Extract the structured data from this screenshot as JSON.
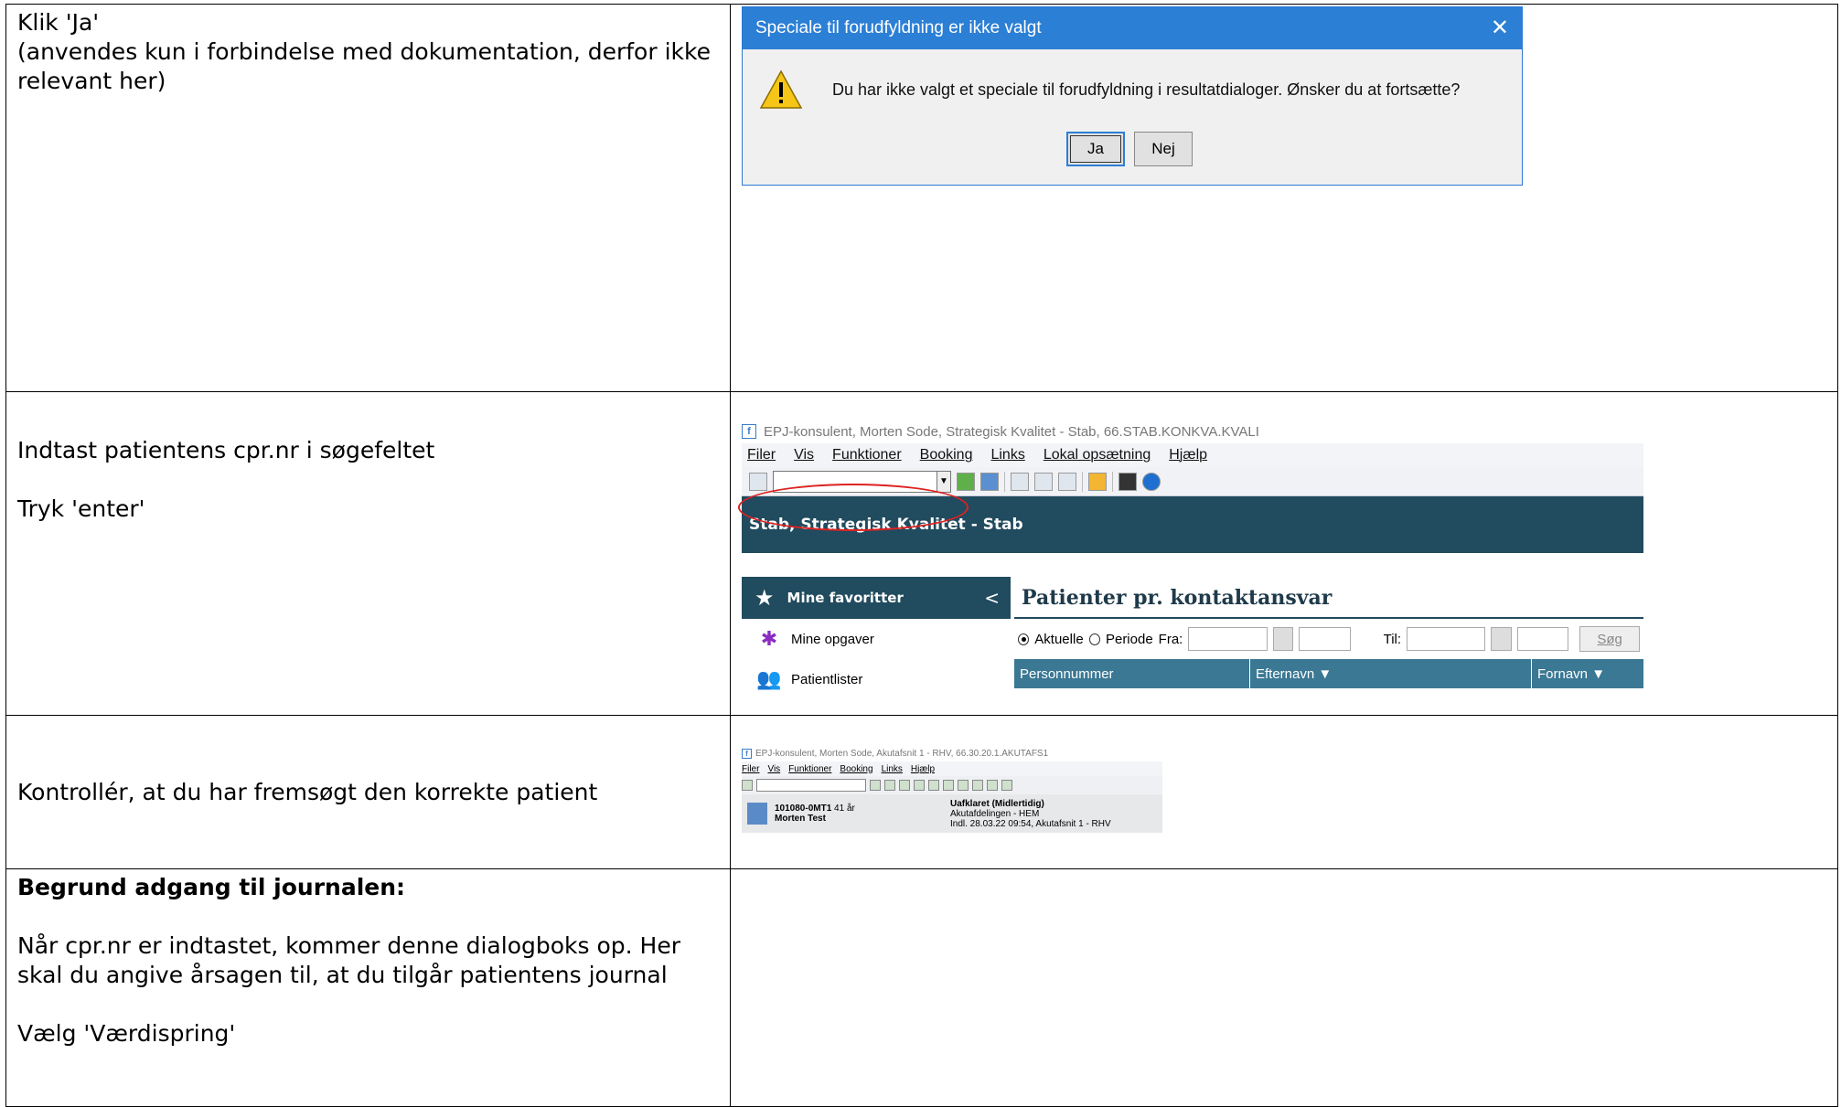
{
  "row1": {
    "instr_lines": [
      "Klik 'Ja'",
      "(anvendes kun i forbindelse med dokumentation, derfor ikke relevant her)"
    ],
    "dialog": {
      "title": "Speciale til forudfyldning er ikke valgt",
      "close": "✕",
      "message": "Du har ikke valgt et speciale til forudfyldning i resultatdialoger. Ønsker du at fortsætte?",
      "yes": "Ja",
      "no": "Nej"
    }
  },
  "row2": {
    "instr1": "Indtast patientens cpr.nr i søgefeltet",
    "instr2": "Tryk 'enter'",
    "app": {
      "title": "EPJ-konsulent, Morten Sode, Strategisk Kvalitet - Stab, 66.STAB.KONKVA.KVALI",
      "menus": [
        "Filer",
        "Vis",
        "Funktioner",
        "Booking",
        "Links",
        "Lokal opsætning",
        "Hjælp"
      ],
      "unit": "Stab, Strategisk Kvalitet - Stab",
      "favorites": "Mine favoritter",
      "side_items": [
        "Mine opgaver",
        "Patientlister"
      ],
      "main_title": "Patienter pr. kontaktansvar",
      "radio1": "Aktuelle",
      "radio2": "Periode",
      "from": "Fra:",
      "to": "Til:",
      "search": "Søg",
      "columns": [
        "Personnummer",
        "Efternavn ▼",
        "Fornavn ▼"
      ]
    }
  },
  "row3": {
    "instr": "Kontrollér, at du har fremsøgt den korrekte patient",
    "app": {
      "title": "EPJ-konsulent, Morten Sode, Akutafsnit 1 - RHV, 66.30.20.1.AKUTAFS1",
      "menus": [
        "Filer",
        "Vis",
        "Funktioner",
        "Booking",
        "Links",
        "Hjælp"
      ],
      "cpr": "101080-0MT1",
      "age": "41 år",
      "name": "Morten Test",
      "status": "Uafklaret (Midlertidig)",
      "dept": "Akutafdelingen - HEM",
      "admitted": "Indl. 28.03.22 09:54, Akutafsnit 1 - RHV"
    }
  },
  "row4": {
    "heading": "Begrund adgang til journalen:",
    "para1": "Når cpr.nr er indtastet, kommer denne dialogboks op. Her skal du angive årsagen til, at du tilgår patientens journal",
    "para2": "Vælg 'Værdispring'"
  }
}
